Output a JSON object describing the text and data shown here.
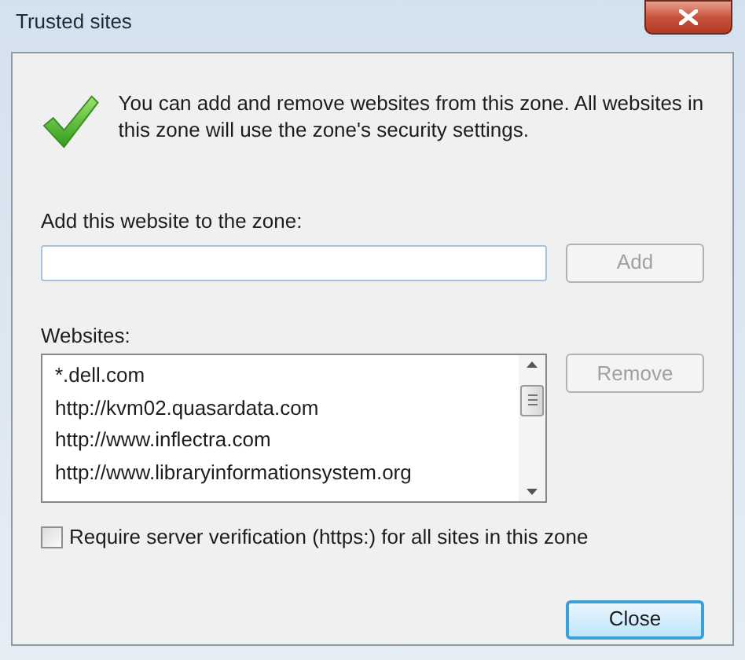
{
  "window": {
    "title": "Trusted sites"
  },
  "info": {
    "text": "You can add and remove websites from this zone. All websites in this zone will use the zone's security settings."
  },
  "add_field": {
    "label": "Add this website to the zone:"
  },
  "add_button": {
    "label": "Add",
    "disabled": true
  },
  "websites": {
    "label": "Websites:",
    "items": [
      {
        "text": "*.dell.com",
        "selected": false
      },
      {
        "text": "http://kvm02.quasardata.com",
        "selected": false
      },
      {
        "text": "http://www.inflectra.com",
        "selected": false
      },
      {
        "text": "http://www.libraryinformationsystem.org",
        "selected": false
      }
    ]
  },
  "remove_button": {
    "label": "Remove",
    "disabled": true
  },
  "require_verification": {
    "label": "Require server verification (https:) for all sites in this zone",
    "checked": false
  },
  "close_button": {
    "label": "Close",
    "disabled": false
  }
}
